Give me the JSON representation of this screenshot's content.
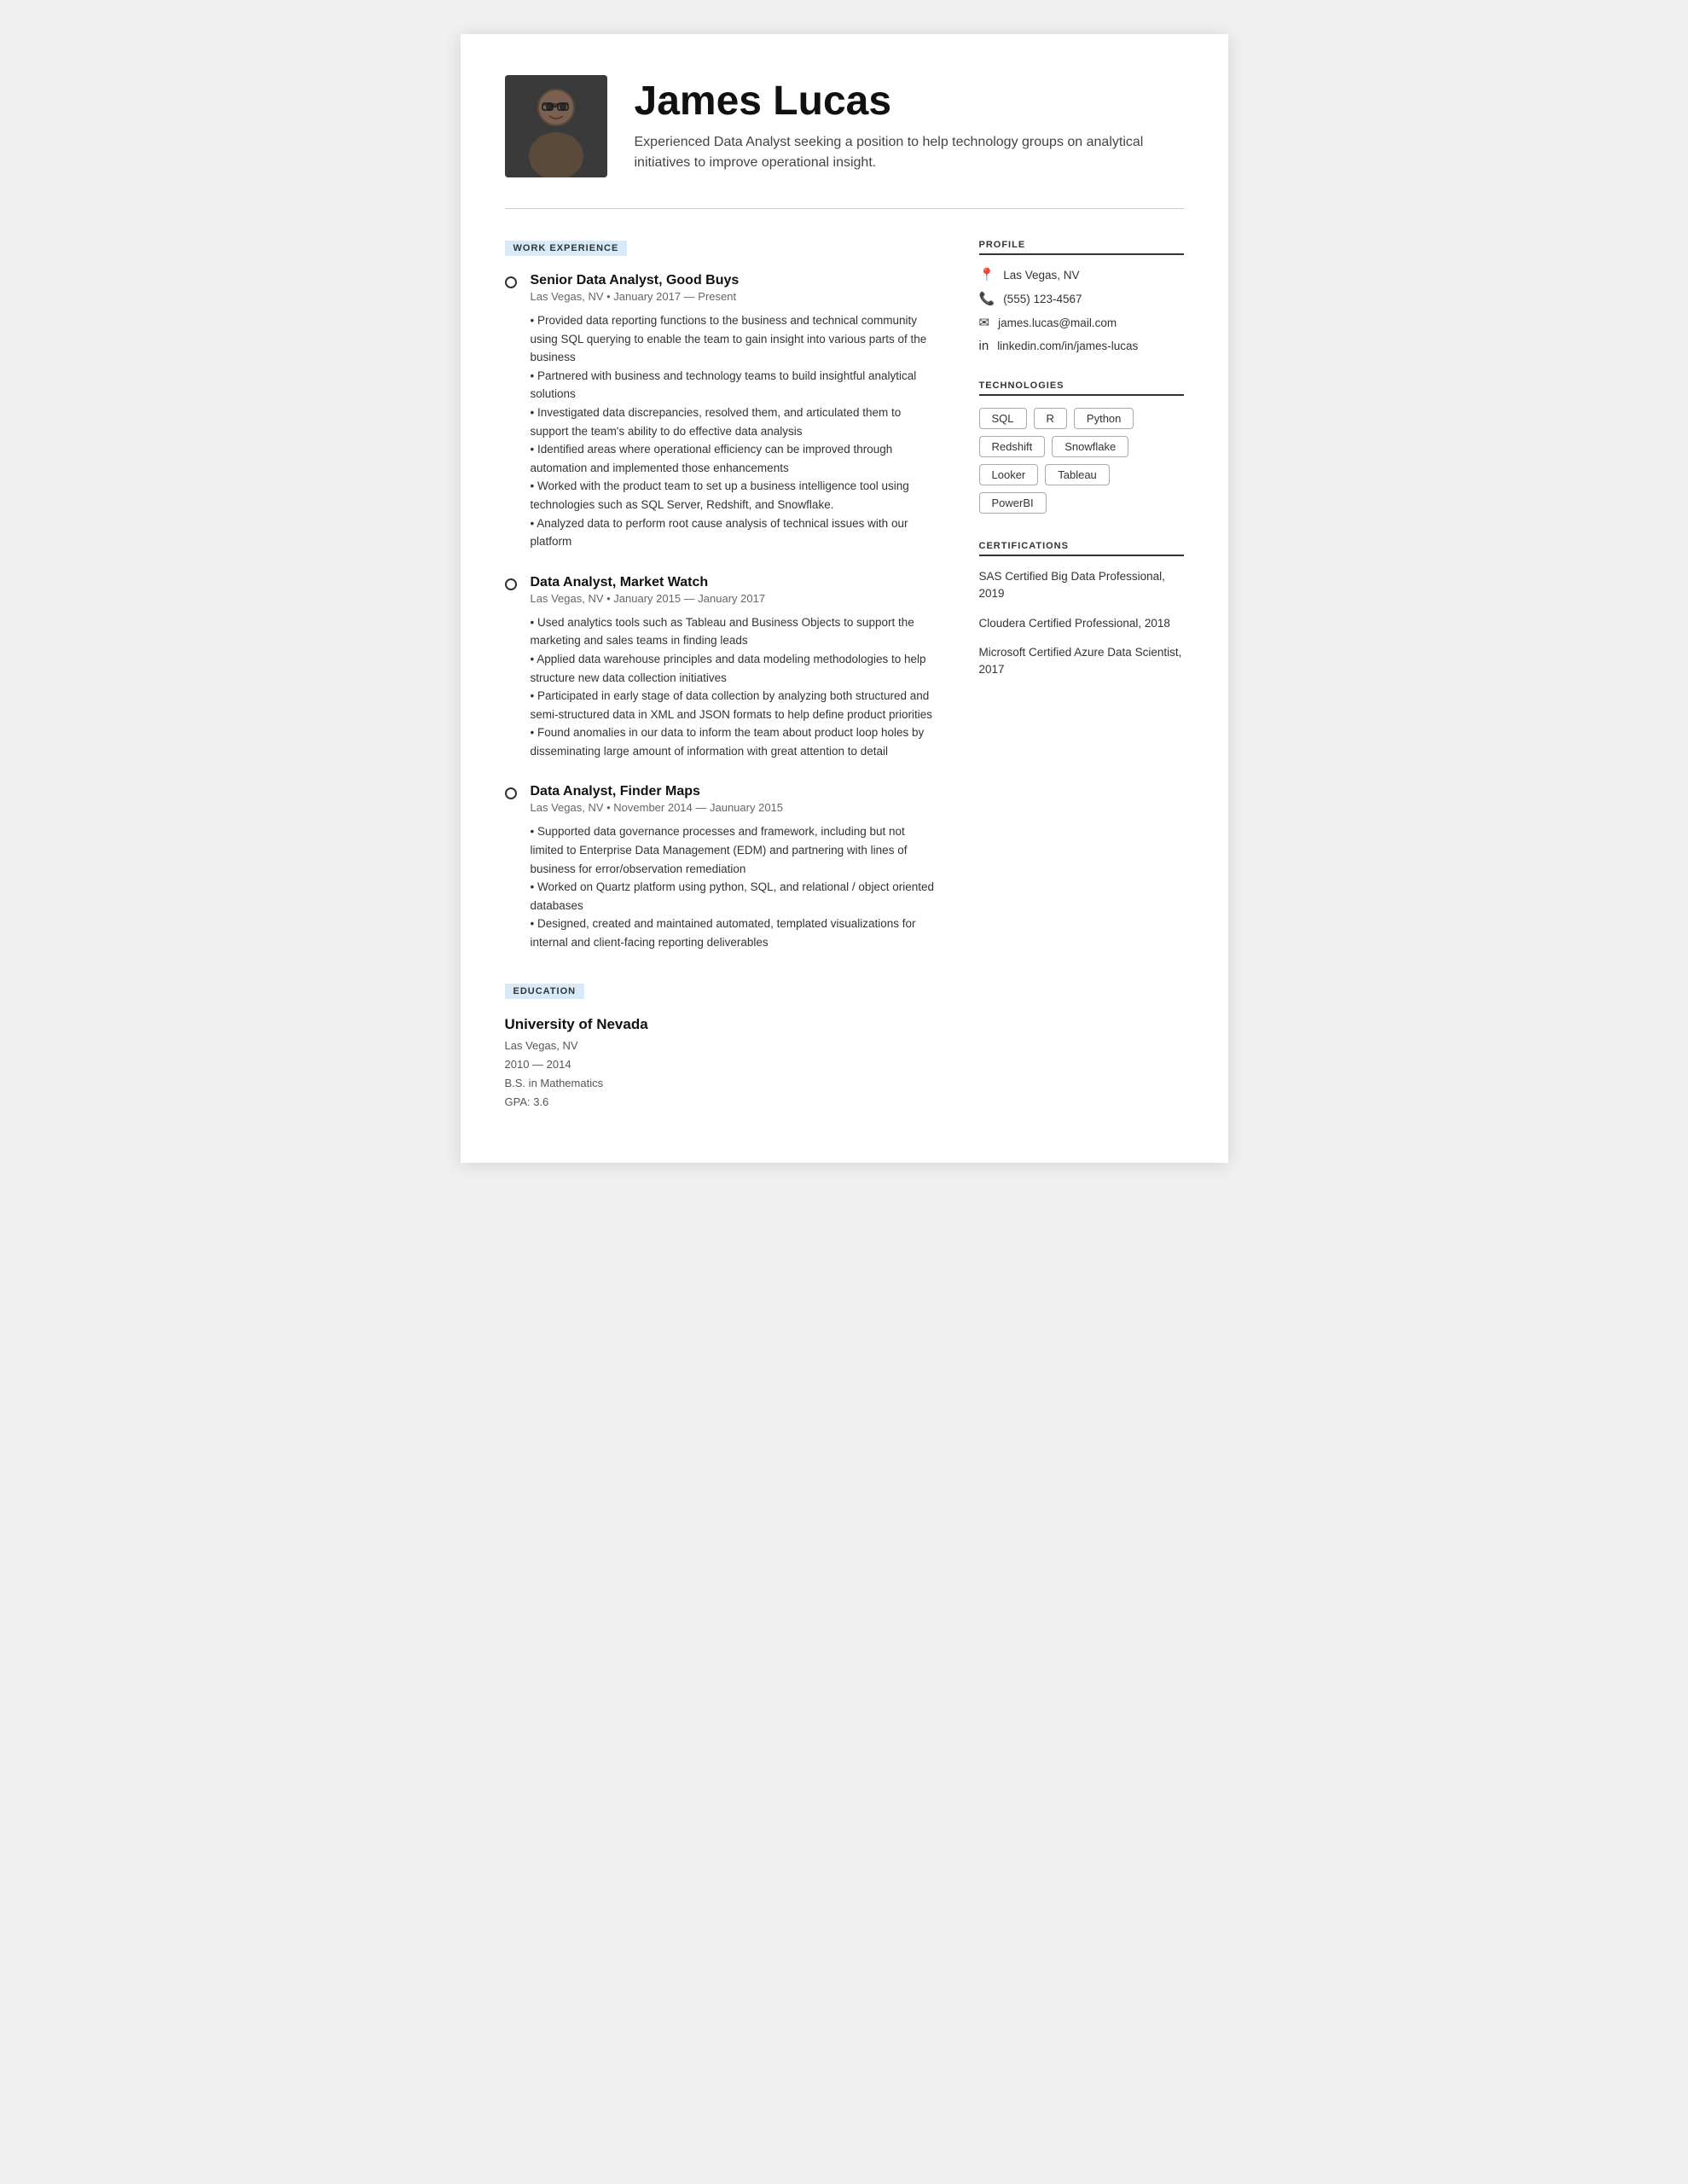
{
  "header": {
    "name": "James Lucas",
    "tagline": "Experienced Data Analyst seeking a position to help technology groups on analytical initiatives to improve operational insight.",
    "avatar_alt": "James Lucas photo"
  },
  "sections": {
    "work_experience_label": "WORK EXPERIENCE",
    "education_label": "EDUCATION",
    "profile_label": "PROFILE",
    "technologies_label": "TECHNOLOGIES",
    "certifications_label": "CERTIFICATIONS"
  },
  "jobs": [
    {
      "title": "Senior Data Analyst, Good Buys",
      "meta": "Las Vegas, NV • January 2017 — Present",
      "description": "• Provided data reporting functions to the business and technical community using SQL querying to enable the team to gain insight into various parts of the business\n• Partnered with business and technology teams to build insightful analytical solutions\n• Investigated data discrepancies, resolved them, and articulated them to support the team's ability to do effective data analysis\n• Identified areas where operational efficiency can be improved through automation and implemented those enhancements\n• Worked with the product team to set up a business intelligence tool using technologies such as SQL Server, Redshift, and Snowflake.\n• Analyzed data to perform root cause analysis of technical issues with our platform"
    },
    {
      "title": "Data Analyst, Market Watch",
      "meta": "Las Vegas, NV • January 2015 — January 2017",
      "description": "• Used analytics tools such as Tableau and Business Objects to support the marketing and sales teams in finding leads\n• Applied data warehouse principles and data modeling methodologies to help structure new data collection initiatives\n• Participated in early stage of data collection by analyzing both structured and semi-structured data in XML and JSON formats to help define product priorities\n• Found anomalies in our data to inform the team about product loop holes by disseminating large amount of information with great attention to detail"
    },
    {
      "title": "Data Analyst, Finder Maps",
      "meta": "Las Vegas, NV • November 2014 — Jaunuary 2015",
      "description": "• Supported data governance processes and framework, including but not limited to Enterprise Data Management (EDM) and partnering with lines of business for error/observation remediation\n• Worked on Quartz platform using python, SQL, and relational / object oriented databases\n• Designed, created and maintained automated, templated visualizations for internal and client-facing reporting deliverables"
    }
  ],
  "education": {
    "school": "University of Nevada",
    "location": "Las Vegas, NV",
    "years": "2010 — 2014",
    "degree": "B.S. in Mathematics",
    "gpa": "GPA: 3.6"
  },
  "profile": {
    "location": "Las Vegas, NV",
    "phone": "(555) 123-4567",
    "email": "james.lucas@mail.com",
    "linkedin": "linkedin.com/in/james-lucas"
  },
  "technologies": [
    "SQL",
    "R",
    "Python",
    "Redshift",
    "Snowflake",
    "Looker",
    "Tableau",
    "PowerBI"
  ],
  "certifications": [
    "SAS Certified Big Data Professional, 2019",
    "Cloudera Certified Professional, 2018",
    "Microsoft Certified Azure Data Scientist, 2017"
  ]
}
